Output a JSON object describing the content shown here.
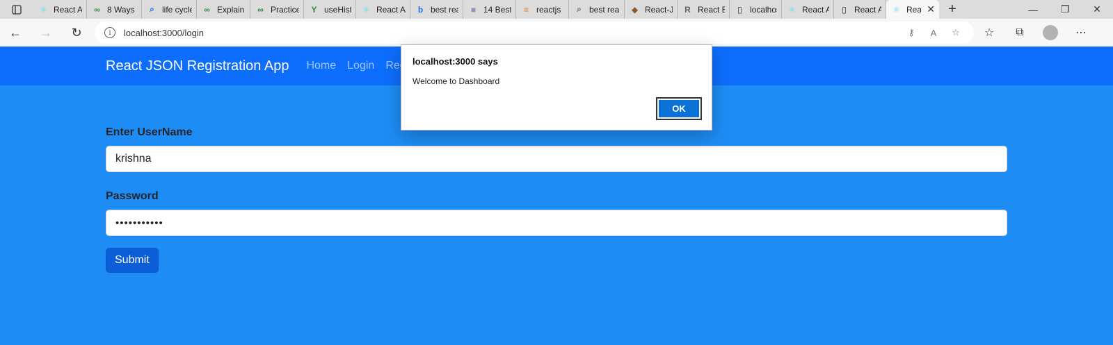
{
  "browser": {
    "tabs": [
      {
        "label": "React A",
        "icon": "react-icon",
        "color": "#61dafb"
      },
      {
        "label": "8 Ways",
        "icon": "gfg-icon",
        "color": "#2f8d46"
      },
      {
        "label": "life cycle",
        "icon": "search-icon",
        "color": "#1a73e8"
      },
      {
        "label": "Explain",
        "icon": "gfg-icon",
        "color": "#2f8d46"
      },
      {
        "label": "Practice",
        "icon": "gfg-icon",
        "color": "#2f8d46"
      },
      {
        "label": "useHist",
        "icon": "y-icon",
        "color": "#2f8d46"
      },
      {
        "label": "React A",
        "icon": "react-icon",
        "color": "#61dafb"
      },
      {
        "label": "best rea",
        "icon": "bing-icon",
        "color": "#1a73e8"
      },
      {
        "label": "14 Best",
        "icon": "site-icon",
        "color": "#9a8fc0"
      },
      {
        "label": "reactjs",
        "icon": "so-icon",
        "color": "#e87922"
      },
      {
        "label": "best rea",
        "icon": "search-icon",
        "color": "#777777"
      },
      {
        "label": "React-JS",
        "icon": "lib-icon",
        "color": "#8b5a2b"
      },
      {
        "label": "React B",
        "icon": "r-icon",
        "color": "#666666"
      },
      {
        "label": "localhos",
        "icon": "page-icon",
        "color": "#333333"
      },
      {
        "label": "React A",
        "icon": "react-icon",
        "color": "#61dafb"
      },
      {
        "label": "React A",
        "icon": "page-icon",
        "color": "#333333"
      },
      {
        "label": "Rea",
        "icon": "react-icon",
        "color": "#61dafb",
        "active": true
      }
    ],
    "url": "localhost:3000/login"
  },
  "navbar": {
    "brand": "React JSON Registration App",
    "links": [
      "Home",
      "Login",
      "Regi"
    ]
  },
  "form": {
    "username_label": "Enter UserName",
    "username_value": "krishna",
    "password_label": "Password",
    "password_value": "•••••••••••",
    "submit_label": "Submit"
  },
  "dialog": {
    "title": "localhost:3000 says",
    "message": "Welcome to Dashboard",
    "ok_label": "OK"
  },
  "colors": {
    "page_bg": "#1e8cf5",
    "navbar_bg": "#0d6efd",
    "submit_bg": "#0b5ed7",
    "ok_bg": "#0a72d6"
  }
}
